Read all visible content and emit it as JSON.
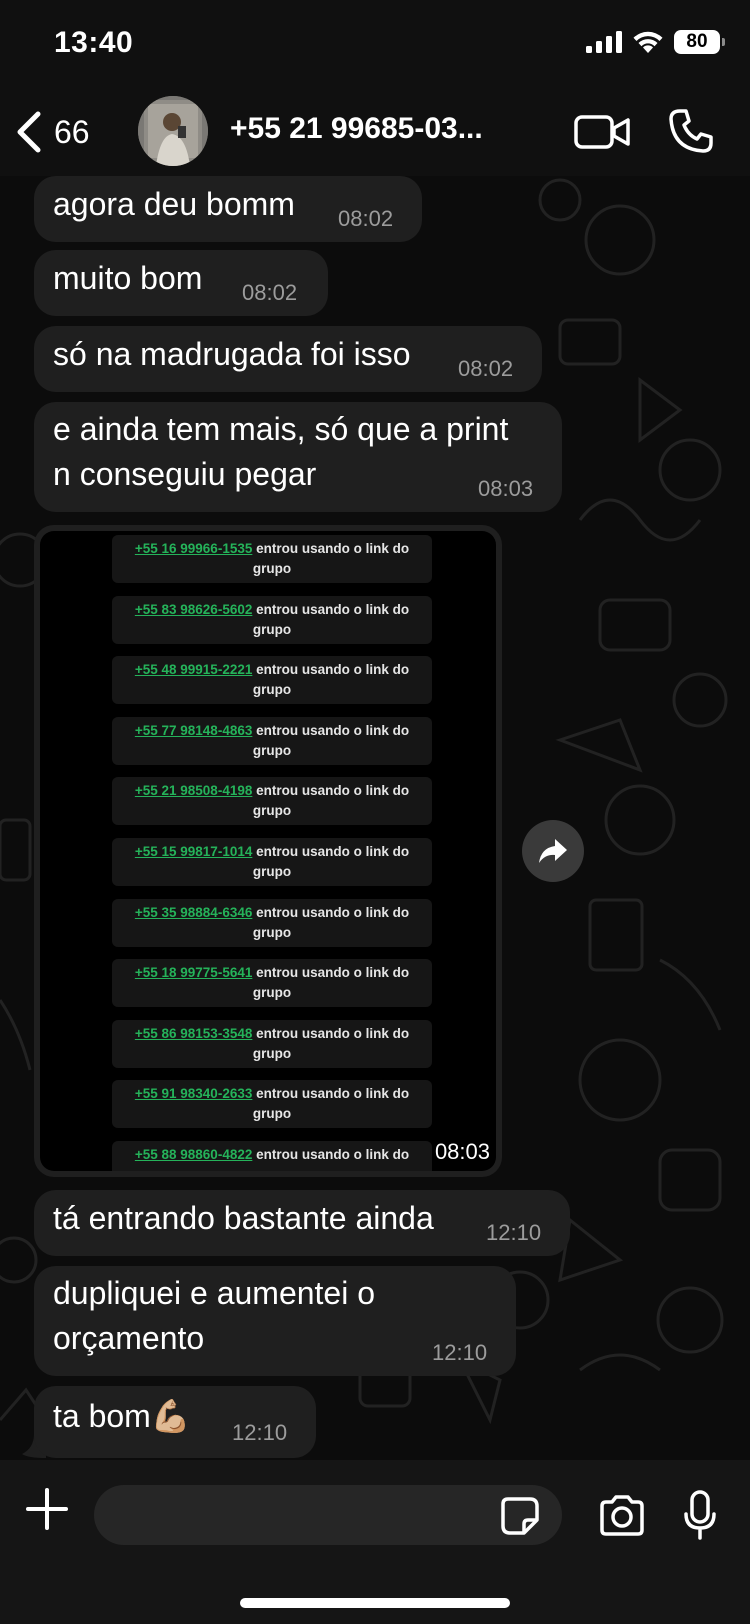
{
  "status_bar": {
    "time": "13:40",
    "battery": "80",
    "icons": [
      "cellular-signal-icon",
      "wifi-icon",
      "battery-icon"
    ]
  },
  "header": {
    "back_count": "66",
    "contact_name": "+55 21 99685-03...",
    "icons": [
      "chevron-left-icon",
      "video-camera-icon",
      "phone-icon"
    ]
  },
  "messages": [
    {
      "text": "agora deu bomm",
      "time": "08:02"
    },
    {
      "text": "muito bom",
      "time": "08:02"
    },
    {
      "text": "só na madrugada foi isso",
      "time": "08:02"
    },
    {
      "lines": [
        "e ainda tem mais, só que a print",
        "n conseguiu pegar"
      ],
      "time": "08:03"
    },
    {
      "text": "tá entrando bastante ainda",
      "time": "12:10"
    },
    {
      "lines": [
        "dupliquei e aumentei o",
        "orçamento"
      ],
      "time": "12:10"
    },
    {
      "text": "ta bom💪🏼",
      "time": "12:10"
    }
  ],
  "image_message": {
    "time": "08:03",
    "join_suffix": "entrou usando o link do",
    "join_suffix_2": "grupo",
    "entries": [
      "+55 16 99966-1535",
      "+55 83 98626-5602",
      "+55 48 99915-2221",
      "+55 77 98148-4863",
      "+55 21 98508-4198",
      "+55 15 99817-1014",
      "+55 35 98884-6346",
      "+55 18 99775-5641",
      "+55 86 98153-3548",
      "+55 91 98340-2633",
      "+55 88 98860-4822"
    ]
  },
  "input_bar": {
    "placeholder": "",
    "icons": [
      "plus-icon",
      "sticker-icon",
      "camera-icon",
      "microphone-icon"
    ]
  },
  "colors": {
    "background": "#0c0c0c",
    "bubble": "#1f1f1f",
    "timestamp": "#9c9c9c",
    "link_green": "#25b35a"
  }
}
